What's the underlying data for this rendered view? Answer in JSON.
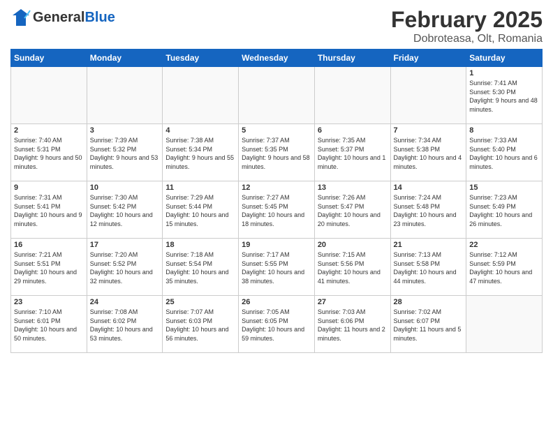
{
  "header": {
    "logo_general": "General",
    "logo_blue": "Blue",
    "month_title": "February 2025",
    "location": "Dobroteasa, Olt, Romania"
  },
  "weekdays": [
    "Sunday",
    "Monday",
    "Tuesday",
    "Wednesday",
    "Thursday",
    "Friday",
    "Saturday"
  ],
  "weeks": [
    [
      {
        "day": "",
        "empty": true
      },
      {
        "day": "",
        "empty": true
      },
      {
        "day": "",
        "empty": true
      },
      {
        "day": "",
        "empty": true
      },
      {
        "day": "",
        "empty": true
      },
      {
        "day": "",
        "empty": true
      },
      {
        "day": "1",
        "info": "Sunrise: 7:41 AM\nSunset: 5:30 PM\nDaylight: 9 hours\nand 48 minutes."
      }
    ],
    [
      {
        "day": "2",
        "info": "Sunrise: 7:40 AM\nSunset: 5:31 PM\nDaylight: 9 hours\nand 50 minutes."
      },
      {
        "day": "3",
        "info": "Sunrise: 7:39 AM\nSunset: 5:32 PM\nDaylight: 9 hours\nand 53 minutes."
      },
      {
        "day": "4",
        "info": "Sunrise: 7:38 AM\nSunset: 5:34 PM\nDaylight: 9 hours\nand 55 minutes."
      },
      {
        "day": "5",
        "info": "Sunrise: 7:37 AM\nSunset: 5:35 PM\nDaylight: 9 hours\nand 58 minutes."
      },
      {
        "day": "6",
        "info": "Sunrise: 7:35 AM\nSunset: 5:37 PM\nDaylight: 10 hours\nand 1 minute."
      },
      {
        "day": "7",
        "info": "Sunrise: 7:34 AM\nSunset: 5:38 PM\nDaylight: 10 hours\nand 4 minutes."
      },
      {
        "day": "8",
        "info": "Sunrise: 7:33 AM\nSunset: 5:40 PM\nDaylight: 10 hours\nand 6 minutes."
      }
    ],
    [
      {
        "day": "9",
        "info": "Sunrise: 7:31 AM\nSunset: 5:41 PM\nDaylight: 10 hours\nand 9 minutes."
      },
      {
        "day": "10",
        "info": "Sunrise: 7:30 AM\nSunset: 5:42 PM\nDaylight: 10 hours\nand 12 minutes."
      },
      {
        "day": "11",
        "info": "Sunrise: 7:29 AM\nSunset: 5:44 PM\nDaylight: 10 hours\nand 15 minutes."
      },
      {
        "day": "12",
        "info": "Sunrise: 7:27 AM\nSunset: 5:45 PM\nDaylight: 10 hours\nand 18 minutes."
      },
      {
        "day": "13",
        "info": "Sunrise: 7:26 AM\nSunset: 5:47 PM\nDaylight: 10 hours\nand 20 minutes."
      },
      {
        "day": "14",
        "info": "Sunrise: 7:24 AM\nSunset: 5:48 PM\nDaylight: 10 hours\nand 23 minutes."
      },
      {
        "day": "15",
        "info": "Sunrise: 7:23 AM\nSunset: 5:49 PM\nDaylight: 10 hours\nand 26 minutes."
      }
    ],
    [
      {
        "day": "16",
        "info": "Sunrise: 7:21 AM\nSunset: 5:51 PM\nDaylight: 10 hours\nand 29 minutes."
      },
      {
        "day": "17",
        "info": "Sunrise: 7:20 AM\nSunset: 5:52 PM\nDaylight: 10 hours\nand 32 minutes."
      },
      {
        "day": "18",
        "info": "Sunrise: 7:18 AM\nSunset: 5:54 PM\nDaylight: 10 hours\nand 35 minutes."
      },
      {
        "day": "19",
        "info": "Sunrise: 7:17 AM\nSunset: 5:55 PM\nDaylight: 10 hours\nand 38 minutes."
      },
      {
        "day": "20",
        "info": "Sunrise: 7:15 AM\nSunset: 5:56 PM\nDaylight: 10 hours\nand 41 minutes."
      },
      {
        "day": "21",
        "info": "Sunrise: 7:13 AM\nSunset: 5:58 PM\nDaylight: 10 hours\nand 44 minutes."
      },
      {
        "day": "22",
        "info": "Sunrise: 7:12 AM\nSunset: 5:59 PM\nDaylight: 10 hours\nand 47 minutes."
      }
    ],
    [
      {
        "day": "23",
        "info": "Sunrise: 7:10 AM\nSunset: 6:01 PM\nDaylight: 10 hours\nand 50 minutes."
      },
      {
        "day": "24",
        "info": "Sunrise: 7:08 AM\nSunset: 6:02 PM\nDaylight: 10 hours\nand 53 minutes."
      },
      {
        "day": "25",
        "info": "Sunrise: 7:07 AM\nSunset: 6:03 PM\nDaylight: 10 hours\nand 56 minutes."
      },
      {
        "day": "26",
        "info": "Sunrise: 7:05 AM\nSunset: 6:05 PM\nDaylight: 10 hours\nand 59 minutes."
      },
      {
        "day": "27",
        "info": "Sunrise: 7:03 AM\nSunset: 6:06 PM\nDaylight: 11 hours\nand 2 minutes."
      },
      {
        "day": "28",
        "info": "Sunrise: 7:02 AM\nSunset: 6:07 PM\nDaylight: 11 hours\nand 5 minutes."
      },
      {
        "day": "",
        "empty": true
      }
    ]
  ]
}
